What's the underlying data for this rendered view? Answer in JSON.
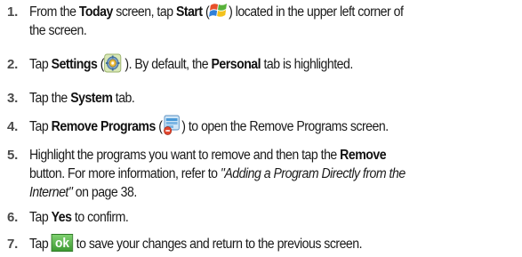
{
  "steps": [
    {
      "number": "1.",
      "t1": "From the ",
      "b1": "Today",
      "t2": " screen, tap ",
      "b2": "Start",
      "t3": " (",
      "icon": "windows-start-icon",
      "t4": ") located in the upper left corner of",
      "line2": "the screen."
    },
    {
      "number": "2.",
      "t1": "Tap ",
      "b1": "Settings",
      "t2": " (",
      "icon": "settings-gear-icon",
      "t3": " ). By default, the ",
      "b2": "Personal",
      "t4": " tab is highlighted."
    },
    {
      "number": "3.",
      "t1": "Tap the ",
      "b1": "System",
      "t2": " tab."
    },
    {
      "number": "4.",
      "t1": "Tap ",
      "b1": "Remove Programs",
      "t2": " (",
      "icon": "remove-programs-icon",
      "t3": ") to open the Remove Programs screen."
    },
    {
      "number": "5.",
      "t1": "Highlight the programs you want to remove and then tap the ",
      "b1": "Remove",
      "line2": "button. For more information, refer to ",
      "i1": "\"Adding a Program Directly from the",
      "i2": "Internet\"",
      "t3": "  on page 38."
    },
    {
      "number": "6.",
      "t1": "Tap ",
      "b1": "Yes",
      "t2": " to confirm."
    },
    {
      "number": "7.",
      "t1": "Tap ",
      "ok_label": "ok",
      "t2": " to save your changes and return to the previous screen."
    }
  ],
  "colors": {
    "ok_button": "#3e9a33",
    "step_number": "#4a4a4a",
    "text": "#1a1a1a"
  }
}
